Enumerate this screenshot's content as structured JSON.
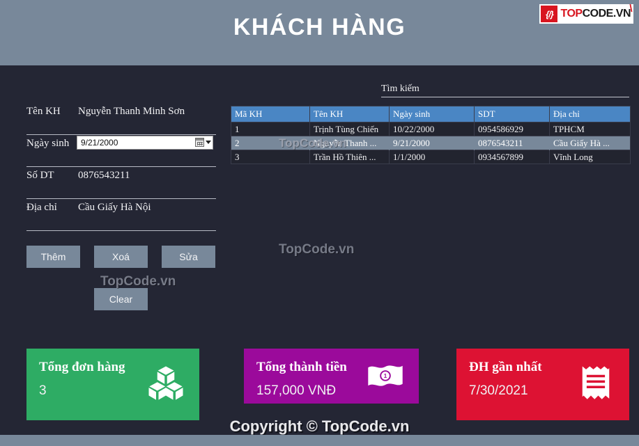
{
  "header": {
    "title": "KHÁCH HÀNG",
    "logo": {
      "mark": "{/}",
      "top": "TOP",
      "code": "CODE",
      "vn": ".VN",
      "tick": "\\"
    }
  },
  "form": {
    "fields": [
      {
        "label": "Tên KH",
        "value": "Nguyễn Thanh Minh Sơn"
      },
      {
        "label": "Ngày sinh",
        "value": "9/21/2000"
      },
      {
        "label": "Số DT",
        "value": "0876543211"
      },
      {
        "label": "Địa chỉ",
        "value": "Cầu Giấy Hà Nội"
      }
    ]
  },
  "buttons": {
    "them": "Thêm",
    "xoa": "Xoá",
    "sua": "Sửa",
    "clear": "Clear"
  },
  "search": {
    "label": "Tìm kiếm",
    "value": ""
  },
  "table": {
    "columns": [
      "Mã KH",
      "Tên KH",
      "Ngày sinh",
      "SDT",
      "Địa chỉ"
    ],
    "rows": [
      {
        "selected": false,
        "cells": [
          "1",
          "Trịnh Tùng Chiến",
          "10/22/2000",
          "0954586929",
          "TPHCM"
        ]
      },
      {
        "selected": true,
        "cells": [
          "2",
          "Nguyễn Thanh ...",
          "9/21/2000",
          "0876543211",
          "Cầu Giấy Hà ..."
        ]
      },
      {
        "selected": false,
        "cells": [
          "3",
          "Trần Hồ Thiên ...",
          "1/1/2000",
          "0934567899",
          "Vĩnh Long"
        ]
      }
    ]
  },
  "cards": [
    {
      "title": "Tổng đơn hàng",
      "value": "3",
      "color": "#2eac64",
      "icon": "boxes-icon"
    },
    {
      "title": "Tổng thành tiền",
      "value": "157,000 VNĐ",
      "color": "#9b0a9b",
      "icon": "banknote-icon"
    },
    {
      "title": "ĐH gần nhất",
      "value": "7/30/2021",
      "color": "#dd1233",
      "icon": "receipt-icon"
    }
  ],
  "watermarks": {
    "table": "TopCode.vn",
    "middle": "TopCode.vn",
    "buttons": "TopCode.vn",
    "footer": "Copyright © TopCode.vn"
  }
}
